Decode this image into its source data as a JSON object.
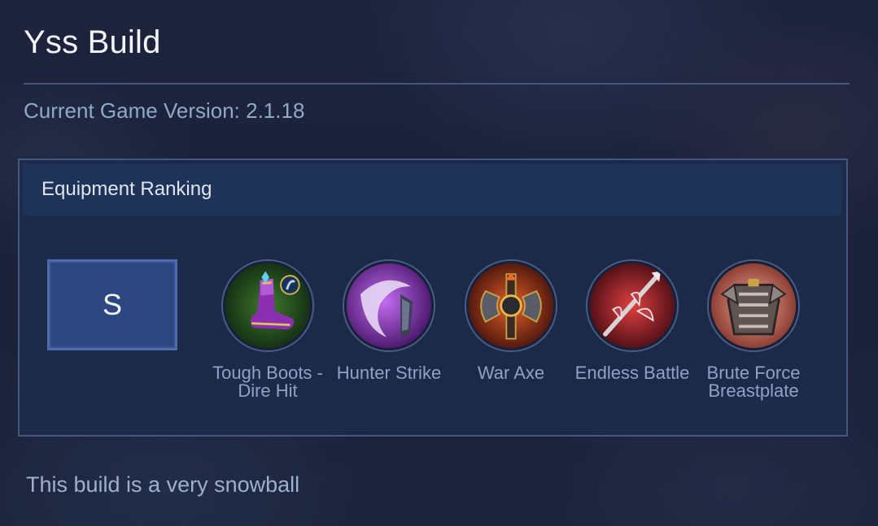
{
  "page": {
    "title": "Yss Build",
    "version_text": "Current Game Version: 2.1.18",
    "description": "This build is a very snowball"
  },
  "ranking": {
    "header": "Equipment Ranking",
    "tier": "S",
    "items": [
      {
        "label": "Tough Boots -\nDire Hit",
        "icon": "tough-boots-icon"
      },
      {
        "label": "Hunter Strike",
        "icon": "hunter-strike-icon"
      },
      {
        "label": "War Axe",
        "icon": "war-axe-icon"
      },
      {
        "label": "Endless Battle",
        "icon": "endless-battle-icon"
      },
      {
        "label": "Brute Force\nBreastplate",
        "icon": "brute-force-breastplate-icon"
      }
    ]
  },
  "colors": {
    "accent": "#2c4680",
    "panel": "#1d2a4a",
    "muted_text": "#8ea3c3"
  }
}
